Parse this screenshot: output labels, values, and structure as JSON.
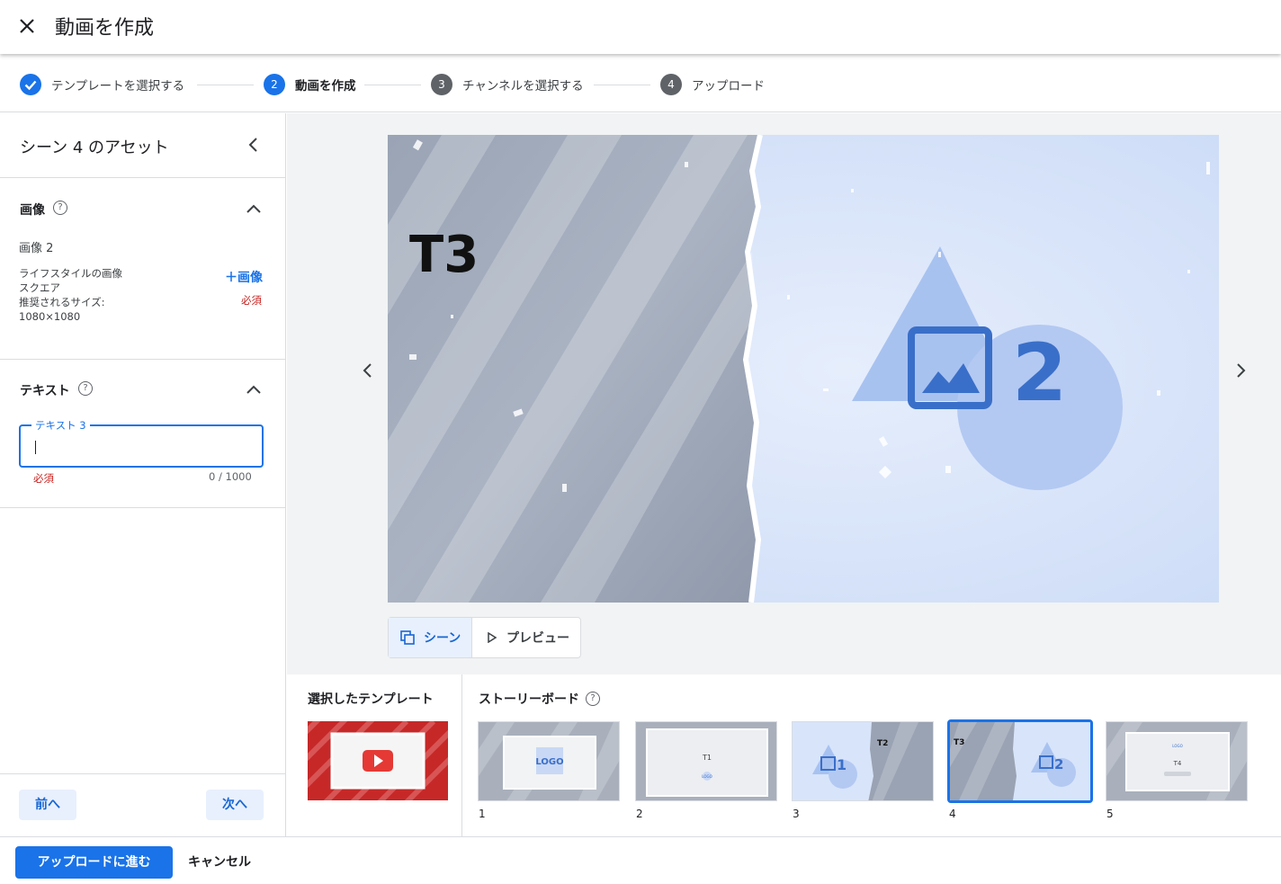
{
  "header": {
    "title": "動画を作成",
    "close_icon": "close-icon"
  },
  "stepper": {
    "steps": [
      {
        "number": "✓",
        "label": "テンプレートを選択する",
        "state": "done"
      },
      {
        "number": "2",
        "label": "動画を作成",
        "state": "active"
      },
      {
        "number": "3",
        "label": "チャンネルを選択する",
        "state": "todo"
      },
      {
        "number": "4",
        "label": "アップロード",
        "state": "todo"
      }
    ]
  },
  "left_panel": {
    "title": "シーン 4 のアセット",
    "image_section": {
      "heading": "画像",
      "item_title": "画像 2",
      "desc_lines": [
        "ライフスタイルの画像",
        "スクエア",
        "推奨されるサイズ:",
        "1080×1080"
      ],
      "add_button": "＋画像",
      "required": "必須"
    },
    "text_section": {
      "heading": "テキスト",
      "field_label": "テキスト 3",
      "value": "",
      "required": "必須",
      "counter": "0 / 1000"
    },
    "prev_button": "前へ",
    "next_button": "次へ"
  },
  "preview": {
    "left_text": "T3",
    "image_number": "2",
    "toggle": {
      "scene_label": "シーン",
      "preview_label": "プレビュー"
    }
  },
  "bottom": {
    "template_heading": "選択したテンプレート",
    "storyboard_heading": "ストーリーボード",
    "thumbs": [
      {
        "number": "1",
        "text": "LOGO"
      },
      {
        "number": "2",
        "text": "T1",
        "sub": "LOGO"
      },
      {
        "number": "3",
        "text": "1",
        "text2": "T2"
      },
      {
        "number": "4",
        "text": "T3",
        "text2": "2"
      },
      {
        "number": "5",
        "text": "T4",
        "sub": "LOGO"
      }
    ]
  },
  "footer": {
    "primary": "アップロードに進む",
    "cancel": "キャンセル"
  },
  "colors": {
    "accent": "#1a73e8",
    "required": "#c5221f",
    "step_done": "#1a73e8",
    "step_todo": "#5f6368"
  }
}
